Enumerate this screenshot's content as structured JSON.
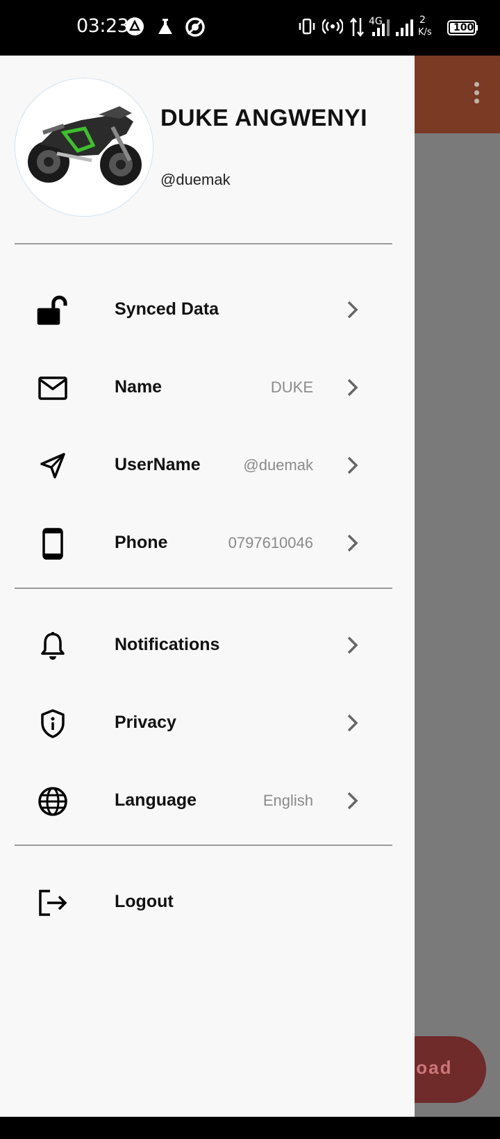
{
  "status_bar": {
    "time": "03:23",
    "network_type": "4G",
    "speed_value": "2",
    "speed_unit": "K/s",
    "battery": "100"
  },
  "drawer": {
    "profile": {
      "name": "DUKE ANGWENYI",
      "handle": "@duemak",
      "avatar_icon": "motorcycle-avatar"
    },
    "account_items": [
      {
        "label": "Synced Data",
        "value": "",
        "icon": "unlock-icon"
      },
      {
        "label": "Name",
        "value": "DUKE",
        "icon": "mail-icon"
      },
      {
        "label": "UserName",
        "value": "@duemak",
        "icon": "send-icon"
      },
      {
        "label": "Phone",
        "value": "0797610046",
        "icon": "phone-icon"
      }
    ],
    "settings_items": [
      {
        "label": "Notifications",
        "value": "",
        "icon": "bell-icon"
      },
      {
        "label": "Privacy",
        "value": "",
        "icon": "shield-icon"
      },
      {
        "label": "Language",
        "value": "English",
        "icon": "globe-icon"
      }
    ],
    "logout": {
      "label": "Logout",
      "icon": "logout-icon"
    }
  },
  "background_app": {
    "fab_label": "load",
    "header_color": "#7a3a24"
  }
}
